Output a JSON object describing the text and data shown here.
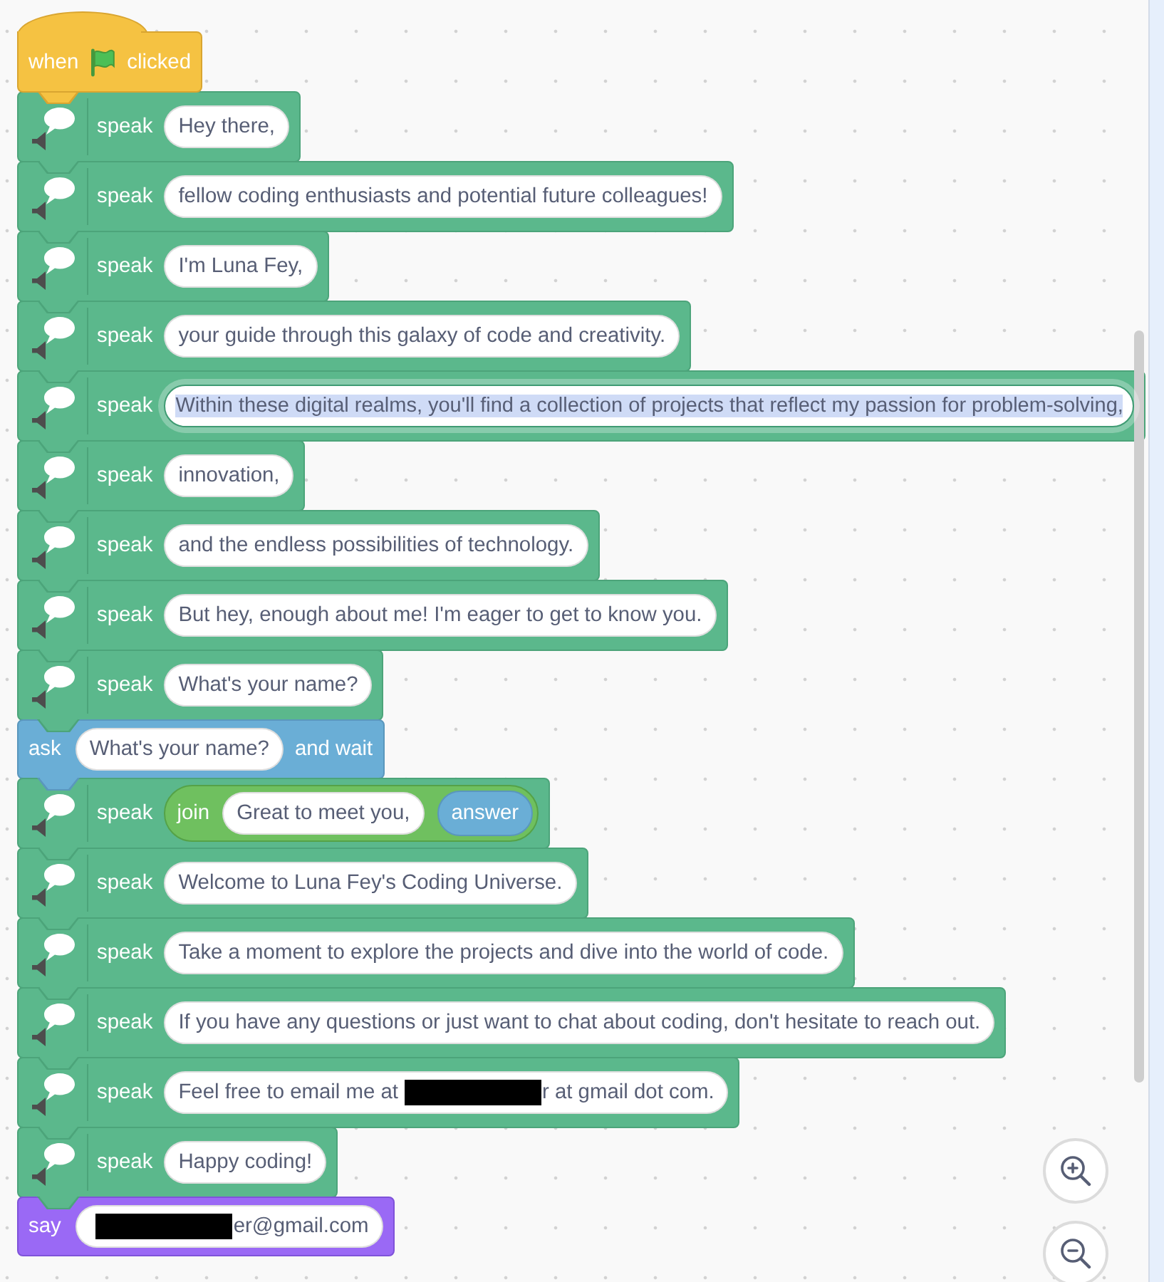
{
  "script": {
    "blocks": [
      {
        "kind": "hat",
        "label": "when",
        "label_after": "clicked"
      },
      {
        "kind": "speak",
        "label": "speak",
        "input": {
          "kind": "text",
          "text": "Hey there,",
          "editing": false
        }
      },
      {
        "kind": "speak",
        "label": "speak",
        "input": {
          "kind": "text",
          "text": "fellow coding enthusiasts and potential future colleagues!",
          "editing": false
        }
      },
      {
        "kind": "speak",
        "label": "speak",
        "input": {
          "kind": "text",
          "text": "I'm Luna Fey,",
          "editing": false
        }
      },
      {
        "kind": "speak",
        "label": "speak",
        "input": {
          "kind": "text",
          "text": "your guide through this galaxy of code and creativity.",
          "editing": false
        }
      },
      {
        "kind": "speak",
        "label": "speak",
        "input": {
          "kind": "text",
          "text": "Within these digital realms, you'll find a collection of projects that reflect my passion for problem-solving,",
          "editing": true
        }
      },
      {
        "kind": "speak",
        "label": "speak",
        "input": {
          "kind": "text",
          "text": "innovation,",
          "editing": false
        }
      },
      {
        "kind": "speak",
        "label": "speak",
        "input": {
          "kind": "text",
          "text": "and the endless possibilities of technology.",
          "editing": false
        }
      },
      {
        "kind": "speak",
        "label": "speak",
        "input": {
          "kind": "text",
          "text": "But hey, enough about me! I'm eager to get to know you.",
          "editing": false
        }
      },
      {
        "kind": "speak",
        "label": "speak",
        "input": {
          "kind": "text",
          "text": "What's your name?",
          "editing": false
        }
      },
      {
        "kind": "ask",
        "label": "ask",
        "input": {
          "kind": "text",
          "text": "What's your name?",
          "editing": false
        },
        "label_after": "and wait"
      },
      {
        "kind": "speak",
        "label": "speak",
        "input": {
          "kind": "join",
          "label": "join",
          "items": [
            {
              "kind": "text",
              "text": "Great to meet you,",
              "editing": false
            },
            {
              "kind": "reporter",
              "text": "answer"
            }
          ]
        }
      },
      {
        "kind": "speak",
        "label": "speak",
        "input": {
          "kind": "text",
          "text": "Welcome to Luna Fey's Coding Universe.",
          "editing": false
        }
      },
      {
        "kind": "speak",
        "label": "speak",
        "input": {
          "kind": "text",
          "text": "Take a moment to explore the projects and dive into the world of code.",
          "editing": false
        }
      },
      {
        "kind": "speak",
        "label": "speak",
        "input": {
          "kind": "text",
          "text": "If you have any questions or just want to chat about coding, don't hesitate to reach out.",
          "editing": false
        }
      },
      {
        "kind": "speak",
        "label": "speak",
        "input": {
          "kind": "redacted",
          "text_before": "Feel free to email me at",
          "text_after": "r at gmail dot com.",
          "editing": false
        }
      },
      {
        "kind": "speak",
        "label": "speak",
        "input": {
          "kind": "text",
          "text": "Happy coding!",
          "editing": false
        }
      },
      {
        "kind": "say",
        "label": "say",
        "input": {
          "kind": "redacted",
          "text_after": "er@gmail.com",
          "editing": false
        }
      }
    ]
  }
}
